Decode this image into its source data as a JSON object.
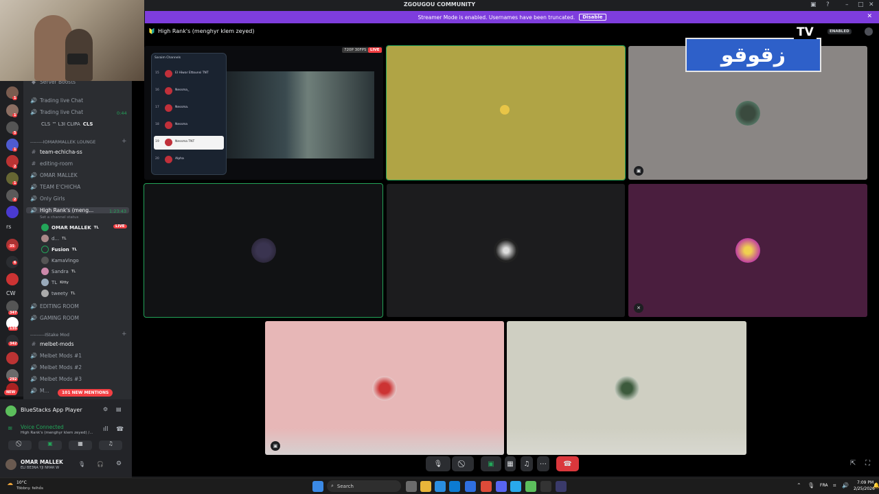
{
  "window": {
    "title": "ZGOUGOU COMMUNITY"
  },
  "banner": {
    "text": "Streamer Mode is enabled. Usernames have been truncated.",
    "button": "Disable"
  },
  "header": {
    "channel": "High Rank's (menghyr klem zeyed)",
    "enabled_badge": "ENABLED",
    "tv_logo": "TV",
    "arabic_logo": "زقوقو"
  },
  "screen_share": {
    "quality": "720P 30FPS",
    "live": "LIVE",
    "overlay_title": "Saraim Channels",
    "overlay_items": [
      {
        "num": "15",
        "name": "El Hiwar Ettounsi TNT"
      },
      {
        "num": "16",
        "name": "Nessma_"
      },
      {
        "num": "17",
        "name": "Nessma."
      },
      {
        "num": "18",
        "name": "Nessma"
      },
      {
        "num": "19",
        "name": "Nessma TNT"
      },
      {
        "num": "20",
        "name": "Alpha"
      }
    ]
  },
  "sidebar": {
    "server_boosts": "Server Boosts",
    "trading_chat_1": "Trading live Chat",
    "trading_chat_2": "Trading live Chat",
    "trading_time": "0:44",
    "trading_user": "CLS ™ L3I CLIPA",
    "trading_tag": "CLS",
    "lounge_cat": "--------IOMARMALLEK LOUNGE",
    "channels_a": [
      "team-echicha-ss",
      "editing-room",
      "OMAR MALLEK",
      "TEAM E'CHICHA",
      "Only Girls"
    ],
    "active_channel": "High Rank's (meng...",
    "active_time": "1:23:43",
    "status_hint": "Set a channel status",
    "voice_users": [
      {
        "name": "OMAR MALLEK",
        "tag": "TL",
        "live": "LIVE"
      },
      {
        "name": "d...",
        "tag": "TL"
      },
      {
        "name": "Fusion",
        "tag": "TL"
      },
      {
        "name": "KamaVingo",
        "tag": ""
      },
      {
        "name": "Sandra",
        "tag": "TL"
      },
      {
        "name": "TL",
        "tag": "Kitty"
      },
      {
        "name": "tweety",
        "tag": "TL"
      }
    ],
    "channels_b": [
      "EDITING ROOM",
      "GAMING ROOM"
    ],
    "stake_cat": "---------IStake Mod",
    "channels_c": [
      "melbet-mods",
      "Melbet Mods #1",
      "Melbet Mods #2",
      "Melbet Mods #3",
      "M..."
    ],
    "new_mentions": "101 NEW MENTIONS",
    "new_badge": "NEW",
    "rail_labels": [
      "rs",
      "CW"
    ],
    "rail_badges": [
      "1",
      "1",
      "5",
      "1",
      "2",
      "1",
      "2",
      "35",
      "6",
      "347",
      "135",
      "342",
      "292"
    ]
  },
  "panel": {
    "activity": "BlueStacks App Player",
    "voice_status": "Voice Connected",
    "voice_channel": "High Rank's (menghyr klem zeyed) /...",
    "user_name": "OMAR MALLEK",
    "user_status": "ELI BE3NA YJI NHAR W"
  },
  "taskbar": {
    "weather_temp": "10°C",
    "weather_desc": "Többny. felhős",
    "search": "Search",
    "lang": "FRA",
    "time": "7:09 PM",
    "date": "2/25/2026"
  },
  "colors": {
    "accent": "#7e3ddd",
    "speaking": "#23a559",
    "danger": "#f23f43"
  }
}
